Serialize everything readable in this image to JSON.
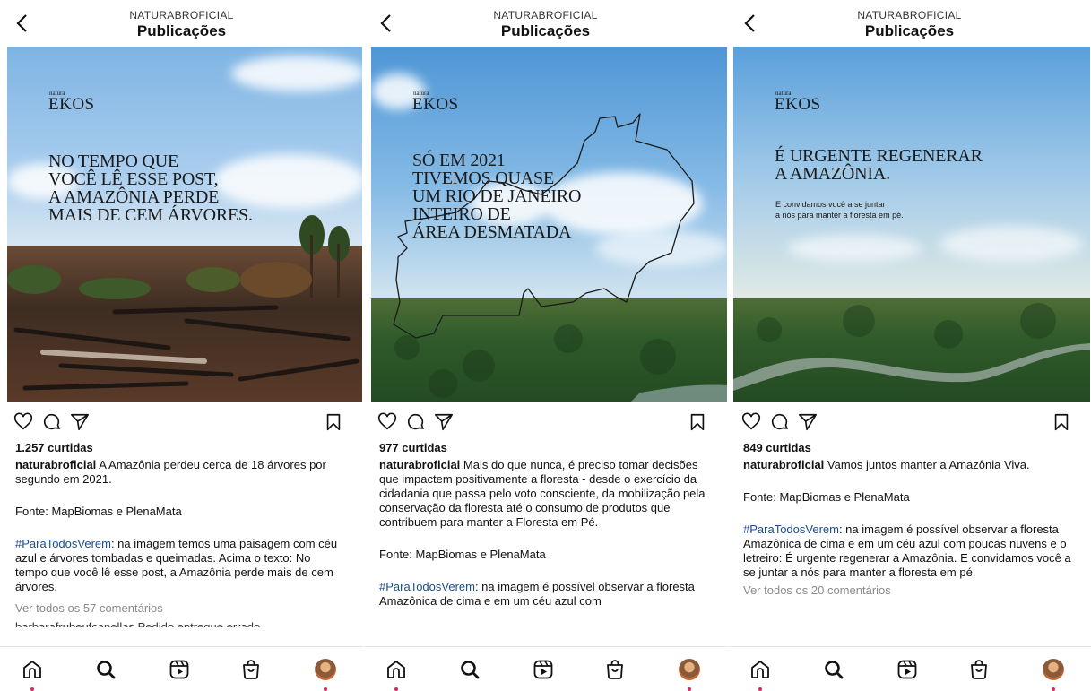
{
  "panels": [
    {
      "account": "NATURABROFICIAL",
      "title": "Publicações",
      "brand_small": "natura",
      "brand": "EKOS",
      "headline": "NO TEMPO QUE\nVOCÊ LÊ ESSE POST,\nA AMAZÔNIA PERDE\nMAIS DE CEM ÁRVORES.",
      "likes": "1.257 curtidas",
      "username": "naturabroficial",
      "caption": "A Amazônia perdeu cerca de 18 árvores por segundo em 2021.",
      "source": "Fonte: MapBiomas e PlenaMata",
      "hashtag": "#ParaTodosVerem",
      "alt": ": na imagem temos uma paisagem com céu azul e árvores tombadas e queimadas. Acima o texto: No tempo que você lê esse post, a Amazônia perde mais de cem árvores.",
      "comments": "Ver todos os 57 comentários",
      "cut_text": "barbarafrubeufcanellas Pedido entregue errado"
    },
    {
      "account": "NATURABROFICIAL",
      "title": "Publicações",
      "brand_small": "natura",
      "brand": "EKOS",
      "headline": "SÓ EM 2021\nTIVEMOS QUASE\nUM RIO DE JANEIRO\nINTEIRO DE\nÁREA DESMATADA",
      "likes": "977 curtidas",
      "username": "naturabroficial",
      "caption": "Mais do que nunca, é preciso tomar decisões que impactem positivamente a floresta - desde o exercício da cidadania que passa pelo voto consciente, da mobilização pela conservação da floresta até o consumo de produtos que contribuem para manter a Floresta em Pé.",
      "source": "Fonte: MapBiomas e PlenaMata",
      "hashtag": "#ParaTodosVerem",
      "alt": ": na imagem é possível observar a floresta Amazônica de cima e em um céu azul com"
    },
    {
      "account": "NATURABROFICIAL",
      "title": "Publicações",
      "brand_small": "natura",
      "brand": "EKOS",
      "headline": "É URGENTE REGENERAR\nA AMAZÔNIA.",
      "subline": "E convidamos você a se juntar\na nós para manter a floresta em pé.",
      "likes": "849 curtidas",
      "username": "naturabroficial",
      "caption": "Vamos juntos manter a Amazônia Viva.",
      "source": "Fonte: MapBiomas e PlenaMata",
      "hashtag": "#ParaTodosVerem",
      "alt": ": na imagem é possível observar a floresta Amazônica de cima e em um céu azul com poucas nuvens e o letreiro: É urgente regenerar a Amazônia. E convidamos você a se juntar a nós para manter a floresta em pé.",
      "comments": "Ver todos os 20 comentários"
    }
  ],
  "icons": {
    "back": "chevron-left-icon",
    "like": "heart-icon",
    "comment": "comment-bubble-icon",
    "share": "send-icon",
    "save": "bookmark-icon",
    "nav": [
      "home-icon",
      "search-icon",
      "reels-icon",
      "shop-icon",
      "profile-avatar"
    ]
  },
  "colors": {
    "hashtag": "#1b4f8c",
    "nav_dot": "#e0245e"
  }
}
